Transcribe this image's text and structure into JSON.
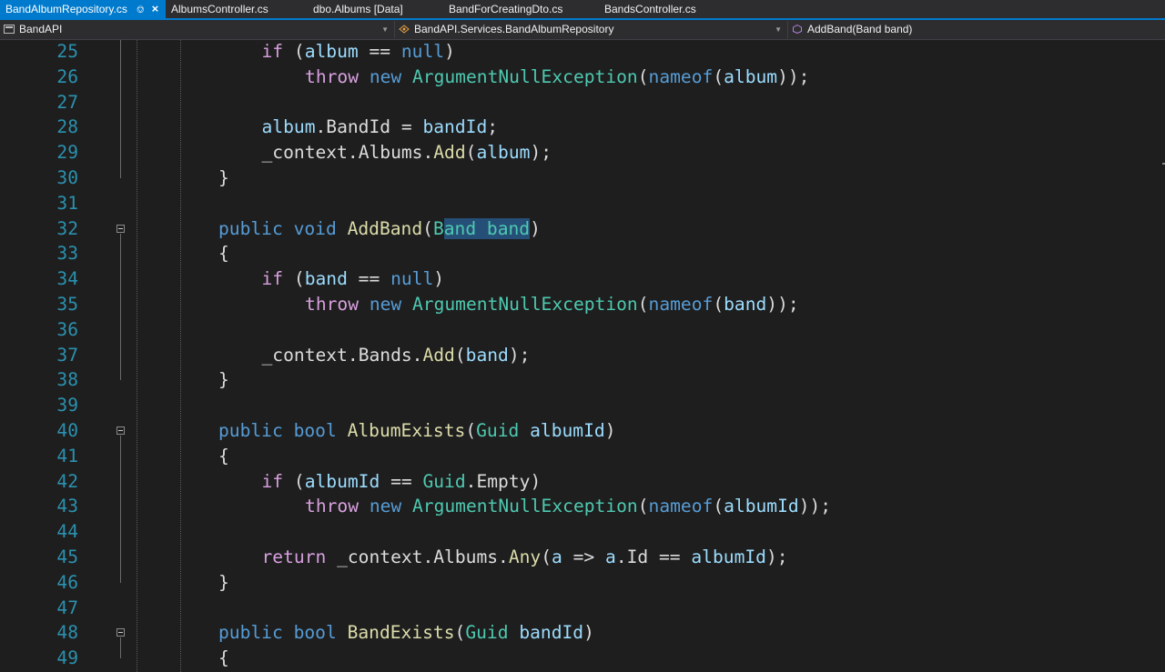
{
  "tabs": [
    {
      "label": "BandAlbumRepository.cs",
      "active": true
    },
    {
      "label": "AlbumsController.cs",
      "active": false
    },
    {
      "label": "dbo.Albums [Data]",
      "active": false
    },
    {
      "label": "BandForCreatingDto.cs",
      "active": false
    },
    {
      "label": "BandsController.cs",
      "active": false
    }
  ],
  "nav": {
    "project": "BandAPI",
    "class": "BandAPI.Services.BandAlbumRepository",
    "member": "AddBand(Band band)"
  },
  "icons": {
    "pin": "pin-icon",
    "close": "close-icon",
    "project": "csharp-project-icon",
    "class": "class-icon",
    "method": "method-icon",
    "dropdown": "chevron-down-icon",
    "fold": "collapse-region-icon"
  },
  "colors": {
    "accent": "#007acc",
    "editor_bg": "#1e1e1e",
    "selection": "#264f78"
  },
  "editor": {
    "lines": [
      {
        "n": "25",
        "indent": 2,
        "t": [
          [
            "ctl",
            "if"
          ],
          [
            "pl",
            " ("
          ],
          [
            "var",
            "album"
          ],
          [
            "pl",
            " == "
          ],
          [
            "kw",
            "null"
          ],
          [
            "pl",
            ")"
          ]
        ]
      },
      {
        "n": "26",
        "indent": 3,
        "t": [
          [
            "ctl",
            "throw"
          ],
          [
            "pl",
            " "
          ],
          [
            "kw",
            "new"
          ],
          [
            "pl",
            " "
          ],
          [
            "typ",
            "ArgumentNullException"
          ],
          [
            "pl",
            "("
          ],
          [
            "kw",
            "nameof"
          ],
          [
            "pl",
            "("
          ],
          [
            "var",
            "album"
          ],
          [
            "pl",
            "));"
          ]
        ]
      },
      {
        "n": "27",
        "indent": 0,
        "t": []
      },
      {
        "n": "28",
        "indent": 2,
        "t": [
          [
            "var",
            "album"
          ],
          [
            "pl",
            "."
          ],
          [
            "pl",
            "BandId"
          ],
          [
            "pl",
            " = "
          ],
          [
            "var",
            "bandId"
          ],
          [
            "pl",
            ";"
          ]
        ]
      },
      {
        "n": "29",
        "indent": 2,
        "t": [
          [
            "pl",
            "_context"
          ],
          [
            "pl",
            "."
          ],
          [
            "pl",
            "Albums"
          ],
          [
            "pl",
            "."
          ],
          [
            "fn",
            "Add"
          ],
          [
            "pl",
            "("
          ],
          [
            "var",
            "album"
          ],
          [
            "pl",
            ");"
          ]
        ]
      },
      {
        "n": "30",
        "indent": 1,
        "t": [
          [
            "pl",
            "}"
          ]
        ]
      },
      {
        "n": "31",
        "indent": 0,
        "t": []
      },
      {
        "n": "32",
        "indent": 1,
        "fold": true,
        "t": [
          [
            "kw",
            "public"
          ],
          [
            "pl",
            " "
          ],
          [
            "kw",
            "void"
          ],
          [
            "pl",
            " "
          ],
          [
            "fn",
            "AddBand"
          ],
          [
            "pl",
            "("
          ],
          [
            "typ",
            "B"
          ],
          [
            "typ",
            "and band",
            "sel"
          ],
          [
            "pl",
            ")"
          ]
        ]
      },
      {
        "n": "33",
        "indent": 1,
        "t": [
          [
            "pl",
            "{"
          ]
        ]
      },
      {
        "n": "34",
        "indent": 2,
        "t": [
          [
            "ctl",
            "if"
          ],
          [
            "pl",
            " ("
          ],
          [
            "var",
            "band"
          ],
          [
            "pl",
            " == "
          ],
          [
            "kw",
            "null"
          ],
          [
            "pl",
            ")"
          ]
        ]
      },
      {
        "n": "35",
        "indent": 3,
        "t": [
          [
            "ctl",
            "throw"
          ],
          [
            "pl",
            " "
          ],
          [
            "kw",
            "new"
          ],
          [
            "pl",
            " "
          ],
          [
            "typ",
            "ArgumentNullException"
          ],
          [
            "pl",
            "("
          ],
          [
            "kw",
            "nameof"
          ],
          [
            "pl",
            "("
          ],
          [
            "var",
            "band"
          ],
          [
            "pl",
            "));"
          ]
        ]
      },
      {
        "n": "36",
        "indent": 0,
        "t": []
      },
      {
        "n": "37",
        "indent": 2,
        "t": [
          [
            "pl",
            "_context"
          ],
          [
            "pl",
            "."
          ],
          [
            "pl",
            "Bands"
          ],
          [
            "pl",
            "."
          ],
          [
            "fn",
            "Add"
          ],
          [
            "pl",
            "("
          ],
          [
            "var",
            "band"
          ],
          [
            "pl",
            ");"
          ]
        ]
      },
      {
        "n": "38",
        "indent": 1,
        "t": [
          [
            "pl",
            "}"
          ]
        ]
      },
      {
        "n": "39",
        "indent": 0,
        "t": []
      },
      {
        "n": "40",
        "indent": 1,
        "fold": true,
        "t": [
          [
            "kw",
            "public"
          ],
          [
            "pl",
            " "
          ],
          [
            "kw",
            "bool"
          ],
          [
            "pl",
            " "
          ],
          [
            "fn",
            "AlbumExists"
          ],
          [
            "pl",
            "("
          ],
          [
            "typ",
            "Guid"
          ],
          [
            "pl",
            " "
          ],
          [
            "var",
            "albumId"
          ],
          [
            "pl",
            ")"
          ]
        ]
      },
      {
        "n": "41",
        "indent": 1,
        "t": [
          [
            "pl",
            "{"
          ]
        ]
      },
      {
        "n": "42",
        "indent": 2,
        "t": [
          [
            "ctl",
            "if"
          ],
          [
            "pl",
            " ("
          ],
          [
            "var",
            "albumId"
          ],
          [
            "pl",
            " == "
          ],
          [
            "typ",
            "Guid"
          ],
          [
            "pl",
            "."
          ],
          [
            "pl",
            "Empty"
          ],
          [
            "pl",
            ")"
          ]
        ]
      },
      {
        "n": "43",
        "indent": 3,
        "t": [
          [
            "ctl",
            "throw"
          ],
          [
            "pl",
            " "
          ],
          [
            "kw",
            "new"
          ],
          [
            "pl",
            " "
          ],
          [
            "typ",
            "ArgumentNullException"
          ],
          [
            "pl",
            "("
          ],
          [
            "kw",
            "nameof"
          ],
          [
            "pl",
            "("
          ],
          [
            "var",
            "albumId"
          ],
          [
            "pl",
            "));"
          ]
        ]
      },
      {
        "n": "44",
        "indent": 0,
        "t": []
      },
      {
        "n": "45",
        "indent": 2,
        "t": [
          [
            "ctl",
            "return"
          ],
          [
            "pl",
            " _context."
          ],
          [
            "pl",
            "Albums"
          ],
          [
            "pl",
            "."
          ],
          [
            "fn",
            "Any"
          ],
          [
            "pl",
            "("
          ],
          [
            "var",
            "a"
          ],
          [
            "pl",
            " => "
          ],
          [
            "var",
            "a"
          ],
          [
            "pl",
            "."
          ],
          [
            "pl",
            "Id"
          ],
          [
            "pl",
            " == "
          ],
          [
            "var",
            "albumId"
          ],
          [
            "pl",
            ");"
          ]
        ]
      },
      {
        "n": "46",
        "indent": 1,
        "t": [
          [
            "pl",
            "}"
          ]
        ]
      },
      {
        "n": "47",
        "indent": 0,
        "t": []
      },
      {
        "n": "48",
        "indent": 1,
        "fold": true,
        "t": [
          [
            "kw",
            "public"
          ],
          [
            "pl",
            " "
          ],
          [
            "kw",
            "bool"
          ],
          [
            "pl",
            " "
          ],
          [
            "fn",
            "BandExists"
          ],
          [
            "pl",
            "("
          ],
          [
            "typ",
            "Guid"
          ],
          [
            "pl",
            " "
          ],
          [
            "var",
            "bandId"
          ],
          [
            "pl",
            ")"
          ]
        ]
      },
      {
        "n": "49",
        "indent": 1,
        "t": [
          [
            "pl",
            "{"
          ]
        ]
      }
    ]
  }
}
